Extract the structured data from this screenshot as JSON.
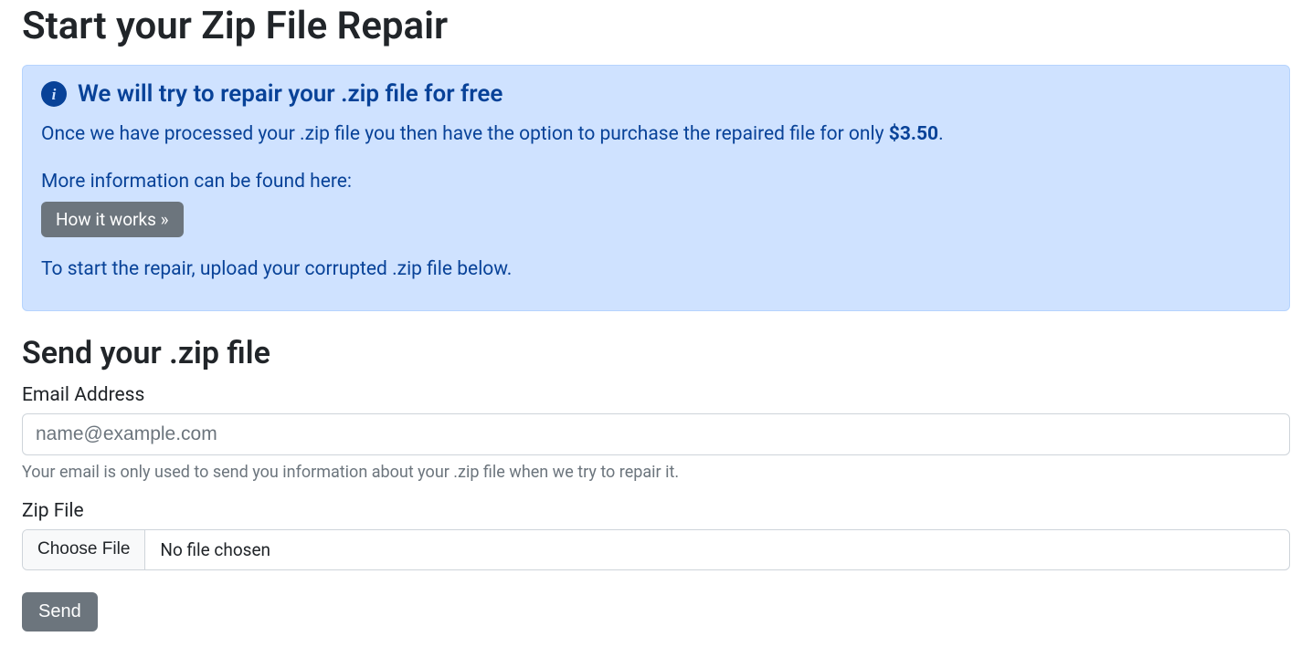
{
  "header": {
    "title": "Start your Zip File Repair"
  },
  "info": {
    "heading": "We will try to repair your .zip file for free",
    "intro_pre": "Once we have processed your .zip file you then have the option to purchase the repaired file for only ",
    "price": "$3.50",
    "intro_post": ".",
    "more_info": "More information can be found here:",
    "how_it_works_label": "How it works »",
    "start_hint": "To start the repair, upload your corrupted .zip file below."
  },
  "form": {
    "heading": "Send your .zip file",
    "email_label": "Email Address",
    "email_placeholder": "name@example.com",
    "email_hint": "Your email is only used to send you information about your .zip file when we try to repair it.",
    "file_label": "Zip File",
    "choose_file": "Choose File",
    "no_file": "No file chosen",
    "send_label": "Send"
  }
}
